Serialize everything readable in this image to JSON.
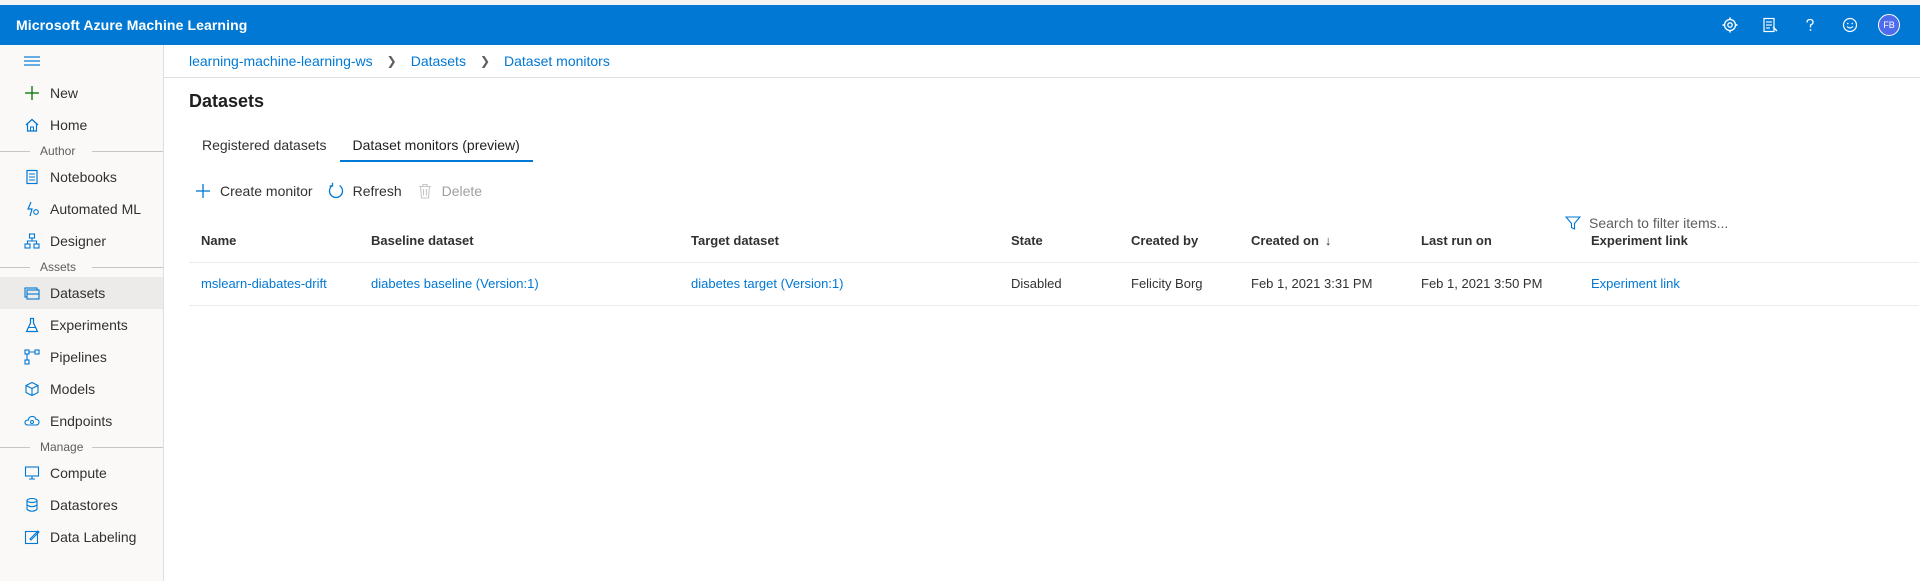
{
  "app": {
    "title": "Microsoft Azure Machine Learning"
  },
  "topbar": {
    "icons": [
      "settings-icon",
      "feedback-icon",
      "help-icon",
      "smiley-icon"
    ],
    "avatar_initials": "FB"
  },
  "sidebar": {
    "items_top": [
      {
        "label": "New",
        "icon": "plus-icon"
      },
      {
        "label": "Home",
        "icon": "home-icon"
      }
    ],
    "sections": [
      {
        "label": "Author",
        "items": [
          {
            "label": "Notebooks",
            "icon": "notebook-icon"
          },
          {
            "label": "Automated ML",
            "icon": "automl-icon"
          },
          {
            "label": "Designer",
            "icon": "designer-icon"
          }
        ]
      },
      {
        "label": "Assets",
        "items": [
          {
            "label": "Datasets",
            "icon": "datasets-icon",
            "active": true
          },
          {
            "label": "Experiments",
            "icon": "flask-icon"
          },
          {
            "label": "Pipelines",
            "icon": "pipelines-icon"
          },
          {
            "label": "Models",
            "icon": "cube-icon"
          },
          {
            "label": "Endpoints",
            "icon": "cloud-icon"
          }
        ]
      },
      {
        "label": "Manage",
        "items": [
          {
            "label": "Compute",
            "icon": "monitor-icon"
          },
          {
            "label": "Datastores",
            "icon": "database-icon"
          },
          {
            "label": "Data Labeling",
            "icon": "edit-icon"
          }
        ]
      }
    ]
  },
  "breadcrumb": [
    "learning-machine-learning-ws",
    "Datasets",
    "Dataset monitors"
  ],
  "page": {
    "title": "Datasets"
  },
  "tabs": [
    {
      "label": "Registered datasets",
      "active": false
    },
    {
      "label": "Dataset monitors (preview)",
      "active": true
    }
  ],
  "toolbar": {
    "create_label": "Create monitor",
    "refresh_label": "Refresh",
    "delete_label": "Delete",
    "search_placeholder": "Search to filter items..."
  },
  "table": {
    "columns": [
      "Name",
      "Baseline dataset",
      "Target dataset",
      "State",
      "Created by",
      "Created on",
      "Last run on",
      "Experiment link"
    ],
    "sort_indicator": "↓",
    "rows": [
      {
        "name": "mslearn-diabates-drift",
        "baseline": "diabetes baseline (Version:1)",
        "target": "diabetes target (Version:1)",
        "state": "Disabled",
        "created_by": "Felicity Borg",
        "created_on": "Feb 1, 2021 3:31 PM",
        "last_run_on": "Feb 1, 2021 3:50 PM",
        "experiment_link": "Experiment link"
      }
    ]
  },
  "colors": {
    "accent": "#0078d4",
    "sidebar_bg": "#faf9f8",
    "active_nav": "#edebe9"
  }
}
